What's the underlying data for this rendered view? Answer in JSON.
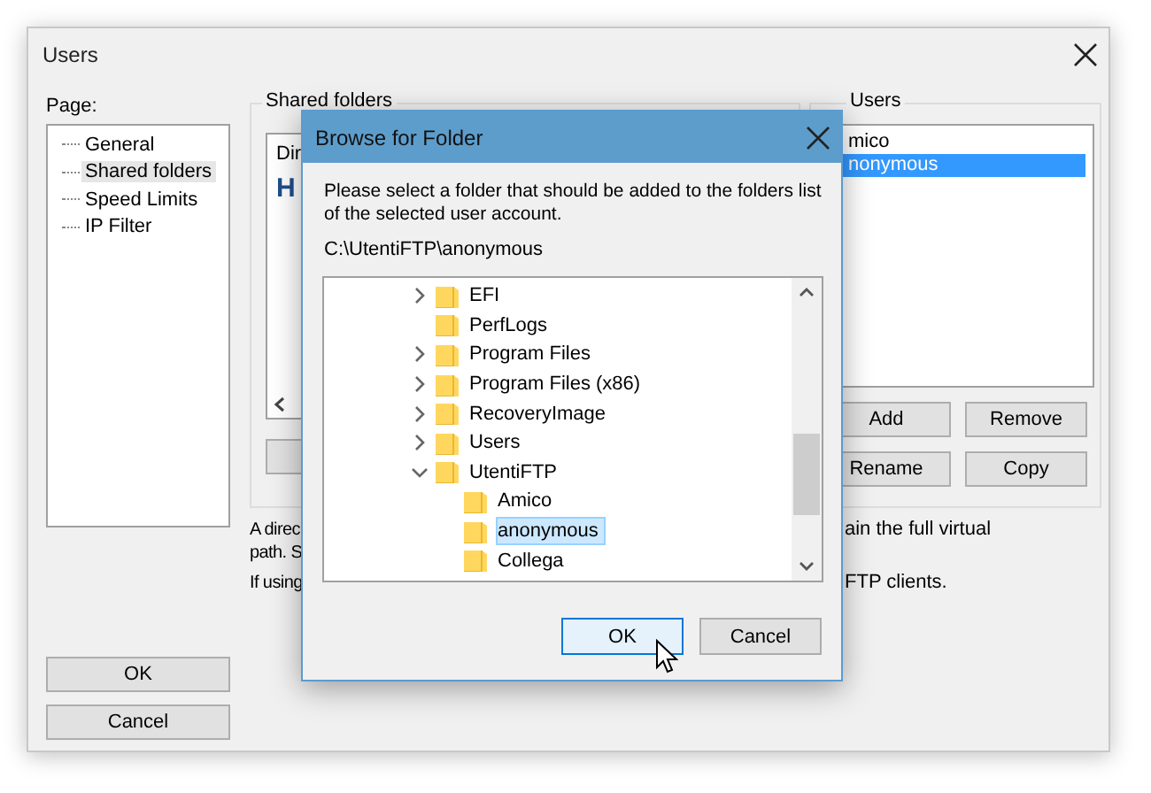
{
  "users_window": {
    "title": "Users",
    "page_label": "Page:",
    "pages": [
      {
        "label": "General",
        "selected": false
      },
      {
        "label": "Shared folders",
        "selected": true
      },
      {
        "label": "Speed Limits",
        "selected": false
      },
      {
        "label": "IP Filter",
        "selected": false
      }
    ],
    "shared_folders": {
      "title": "Shared folders",
      "column_1": "Dir",
      "row_1": "H"
    },
    "users": {
      "title": "Users",
      "list": [
        {
          "name": "mico",
          "selected": false
        },
        {
          "name": "nonymous",
          "selected": true
        }
      ],
      "buttons": [
        "Add",
        "Remove",
        "Rename",
        "Copy"
      ]
    },
    "description": [
      {
        "left": "A direc",
        "right": "ain the full virtual"
      },
      {
        "left": "path. S"
      },
      {
        "left": "If using",
        "right": "FTP clients."
      }
    ],
    "buttons": [
      "OK",
      "Cancel"
    ]
  },
  "browse_dialog": {
    "title": "Browse for Folder",
    "prompt": "Please select a folder that should be added to the folders list of the selected user account.",
    "path": "C:\\UtentiFTP\\anonymous",
    "tree": [
      {
        "label": "EFI",
        "expanded": false,
        "selected": false
      },
      {
        "label": "PerfLogs",
        "selected": false
      },
      {
        "label": "Program Files",
        "expanded": false,
        "selected": false
      },
      {
        "label": "Program Files (x86)",
        "expanded": false,
        "selected": false
      },
      {
        "label": "RecoveryImage",
        "expanded": false,
        "selected": false
      },
      {
        "label": "Users",
        "expanded": false,
        "selected": false
      },
      {
        "label": "UtentiFTP",
        "expanded": true,
        "selected": false,
        "children": [
          {
            "label": "Amico",
            "selected": false
          },
          {
            "label": "anonymous",
            "selected": true
          },
          {
            "label": "Collega",
            "selected": false
          }
        ]
      }
    ],
    "buttons": [
      {
        "label": "OK",
        "focused": true
      },
      {
        "label": "Cancel",
        "focused": false
      }
    ]
  }
}
